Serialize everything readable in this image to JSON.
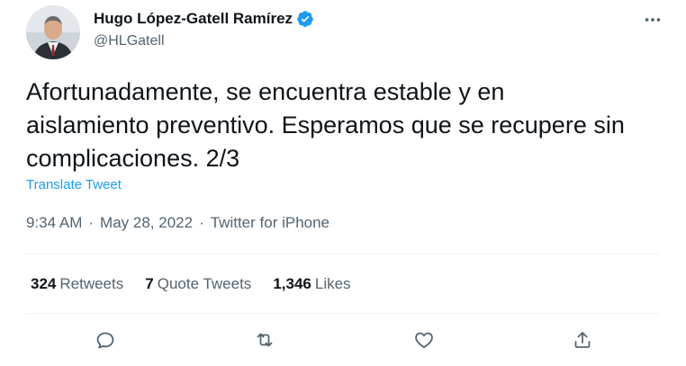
{
  "author": {
    "display_name": "Hugo López-Gatell Ramírez",
    "handle": "@HLGatell",
    "verified": true
  },
  "tweet": {
    "text": "Afortunadamente, se encuentra estable y en\naislamiento preventivo. Esperamos que se recupere sin\ncomplicaciones. 2/3",
    "translate_label": "Translate Tweet",
    "time": "9:34 AM",
    "date": "May 28, 2022",
    "separator": "·",
    "source": "Twitter for iPhone"
  },
  "stats": {
    "retweets": {
      "count": "324",
      "label": "Retweets"
    },
    "quote_tweets": {
      "count": "7",
      "label": "Quote Tweets"
    },
    "likes": {
      "count": "1,346",
      "label": "Likes"
    }
  },
  "icons": {
    "more": "more-horizontal-icon",
    "reply": "reply-icon",
    "retweet": "retweet-icon",
    "like": "heart-icon",
    "share": "share-icon",
    "verified": "verified-badge-icon"
  },
  "colors": {
    "accent": "#1d9bf0",
    "text_primary": "#0f1419",
    "text_secondary": "#536471",
    "divider": "#eff3f4"
  }
}
